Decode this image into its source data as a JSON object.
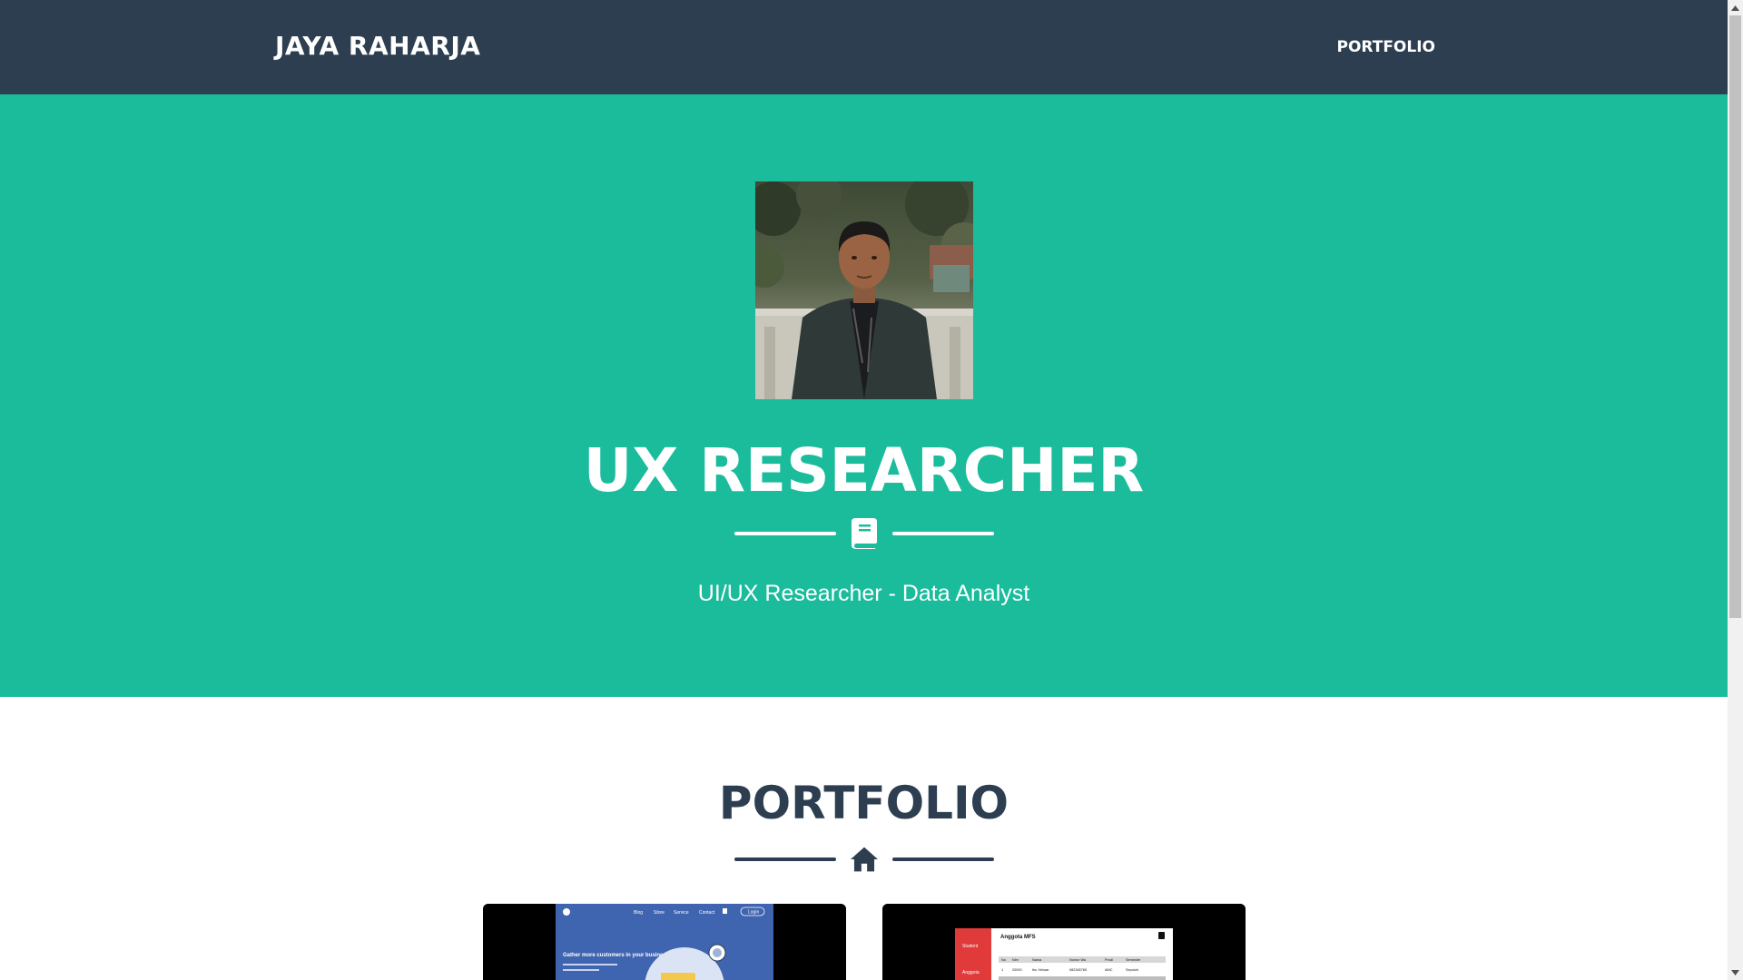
{
  "navbar": {
    "brand": "JAYA RAHARJA",
    "links": [
      {
        "label": "PORTFOLIO"
      }
    ],
    "background": "#2c3e50"
  },
  "masthead": {
    "heading": "UX RESEARCHER",
    "divider_icon": "book-icon",
    "subheading": "UI/UX Researcher - Data Analyst",
    "background": "#1abc9c"
  },
  "portfolio": {
    "heading": "PORTFOLIO",
    "divider_icon": "home-icon",
    "items": [
      {
        "nav_links": [
          "Blog",
          "Store",
          "Service",
          "Contact"
        ],
        "login_label": "Login",
        "hero_text": "Gather more customers in your business area"
      },
      {
        "app_title": "Anggota MFS",
        "sidebar_items": [
          "Student",
          "Anggota"
        ],
        "table_headers": [
          "No",
          "Nim",
          "Nama",
          "Nomor Wa",
          "Prodi",
          "Semester"
        ],
        "table_row": [
          "1",
          "20000",
          "Ibu Yahuar",
          "082345765",
          "AMC",
          "Sepuluh"
        ]
      }
    ]
  },
  "colors": {
    "primary": "#2c3e50",
    "accent": "#1abc9c",
    "text_light": "#ffffff"
  }
}
